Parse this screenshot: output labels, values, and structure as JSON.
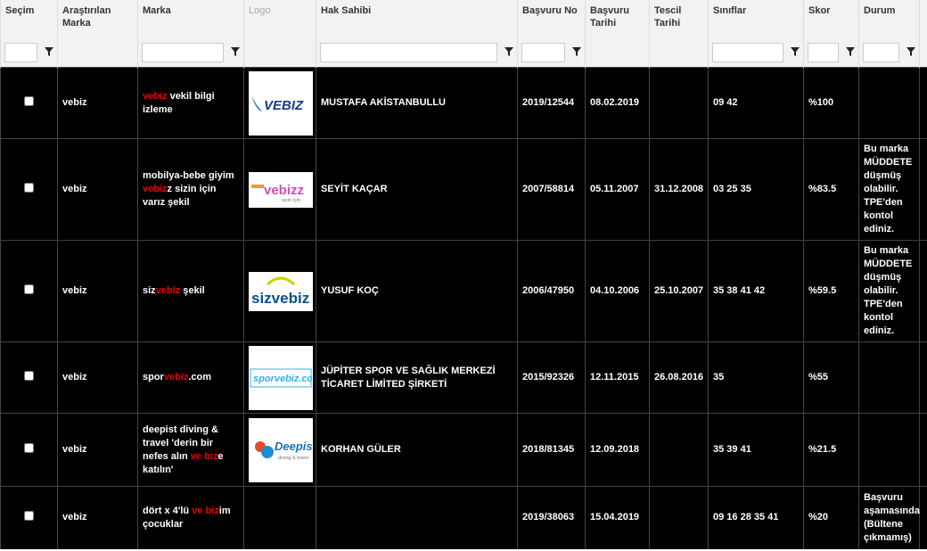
{
  "headers": {
    "secim": "Seçim",
    "arastirilan": "Araştırılan Marka",
    "marka": "Marka",
    "logo": "Logo",
    "hak_sahibi": "Hak Sahibi",
    "basvuru_no": "Başvuru No",
    "basvuru_tarihi": "Başvuru Tarihi",
    "tescil_tarihi": "Tescil Tarihi",
    "siniflar": "Sınıflar",
    "skor": "Skor",
    "durum": "Durum"
  },
  "rows": [
    {
      "arastirilan": "vebiz",
      "marka": [
        {
          "t": "vebiz",
          "r": true
        },
        {
          "t": " vekil bilgi izleme",
          "r": false
        }
      ],
      "logo": "VEBIZ",
      "hak_sahibi": "MUSTAFA AKİSTANBULLU",
      "basvuru_no": "2019/12544",
      "basvuru_tarihi": "08.02.2019",
      "tescil_tarihi": "",
      "siniflar": "09 42",
      "skor": "%100",
      "durum": ""
    },
    {
      "arastirilan": "vebiz",
      "marka": [
        {
          "t": "mobilya-bebe giyim ",
          "r": false
        },
        {
          "t": "vebiz",
          "r": true
        },
        {
          "t": "z sizin için varız şekil",
          "r": false
        }
      ],
      "logo": "vebizz",
      "hak_sahibi": "SEYİT KAÇAR",
      "basvuru_no": "2007/58814",
      "basvuru_tarihi": "05.11.2007",
      "tescil_tarihi": "31.12.2008",
      "siniflar": "03 25 35",
      "skor": "%83.5",
      "durum": "Bu marka MÜDDETE düşmüş olabilir. TPE'den kontol ediniz."
    },
    {
      "arastirilan": "vebiz",
      "marka": [
        {
          "t": "siz",
          "r": false
        },
        {
          "t": "vebiz",
          "r": true
        },
        {
          "t": " şekil",
          "r": false
        }
      ],
      "logo": "sizvebiz",
      "hak_sahibi": "YUSUF KOÇ",
      "basvuru_no": "2006/47950",
      "basvuru_tarihi": "04.10.2006",
      "tescil_tarihi": "25.10.2007",
      "siniflar": "35 38 41 42",
      "skor": "%59.5",
      "durum": "Bu marka MÜDDETE düşmüş olabilir. TPE'den kontol ediniz."
    },
    {
      "arastirilan": "vebiz",
      "marka": [
        {
          "t": "spor",
          "r": false
        },
        {
          "t": "vebiz",
          "r": true
        },
        {
          "t": ".com",
          "r": false
        }
      ],
      "logo": "sporvebiz.com",
      "hak_sahibi": "JÜPİTER SPOR VE SAĞLIK MERKEZİ TİCARET LİMİTED ŞİRKETİ",
      "basvuru_no": "2015/92326",
      "basvuru_tarihi": "12.11.2015",
      "tescil_tarihi": "26.08.2016",
      "siniflar": "35",
      "skor": "%55",
      "durum": ""
    },
    {
      "arastirilan": "vebiz",
      "marka": [
        {
          "t": "deepist diving & travel 'derin bir nefes alın ",
          "r": false
        },
        {
          "t": "ve",
          "r": true
        },
        {
          "t": " ",
          "r": false
        },
        {
          "t": "biz",
          "r": true
        },
        {
          "t": "e katılın'",
          "r": false
        }
      ],
      "logo": "Deepist",
      "hak_sahibi": "KORHAN GÜLER",
      "basvuru_no": "2018/81345",
      "basvuru_tarihi": "12.09.2018",
      "tescil_tarihi": "",
      "siniflar": "35 39 41",
      "skor": "%21.5",
      "durum": ""
    },
    {
      "arastirilan": "vebiz",
      "marka": [
        {
          "t": "dört x 4'lü ",
          "r": false
        },
        {
          "t": "ve",
          "r": true
        },
        {
          "t": " ",
          "r": false
        },
        {
          "t": "biz",
          "r": true
        },
        {
          "t": "im çocuklar",
          "r": false
        }
      ],
      "logo": "",
      "hak_sahibi": "",
      "basvuru_no": "2019/38063",
      "basvuru_tarihi": "15.04.2019",
      "tescil_tarihi": "",
      "siniflar": "09 16 28 35 41",
      "skor": "%20",
      "durum": "Başvuru aşamasında (Bültene çıkmamış)"
    }
  ],
  "colors": {
    "highlight": "#e80000",
    "row_bg": "#000000",
    "header_bg": "#f2f2f2"
  },
  "icons": {
    "filter": "filter-icon",
    "checkbox": "checkbox"
  }
}
